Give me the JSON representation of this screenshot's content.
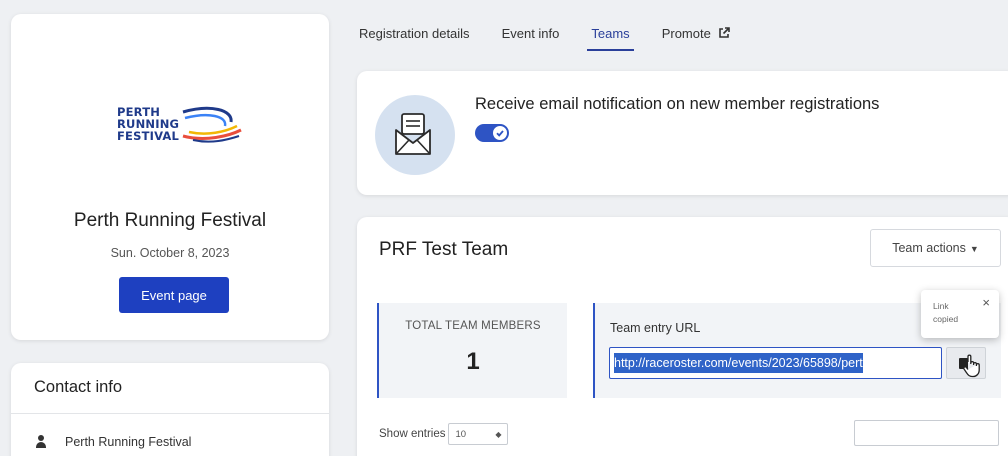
{
  "event": {
    "logo_lines": [
      "PERTH",
      "RUNNING",
      "FESTIVAL"
    ],
    "name": "Perth Running Festival",
    "date": "Sun. October 8, 2023",
    "event_page_label": "Event page"
  },
  "contact": {
    "title": "Contact info",
    "organizer": "Perth Running Festival"
  },
  "tabs": [
    {
      "label": "Registration details",
      "active": false
    },
    {
      "label": "Event info",
      "active": false
    },
    {
      "label": "Teams",
      "active": true
    },
    {
      "label": "Promote",
      "active": false,
      "icon": "external-link-icon"
    }
  ],
  "notification": {
    "text": "Receive email notification on new member registrations",
    "enabled": true
  },
  "team": {
    "name": "PRF Test Team",
    "actions_label": "Team actions",
    "total_members_label": "TOTAL TEAM MEMBERS",
    "total_members_value": "1",
    "entry_url_label": "Team entry URL",
    "entry_url_value": "http://raceroster.com/events/2023/65898/pert",
    "tooltip_text": "Link copied",
    "tooltip_close": "×",
    "show_entries_label": "Show entries",
    "entries_value": "10",
    "search_value": ""
  },
  "colors": {
    "accent": "#2e54c4",
    "button": "#1e40c0",
    "selection": "#2f63c8",
    "background": "#eef0f3"
  }
}
